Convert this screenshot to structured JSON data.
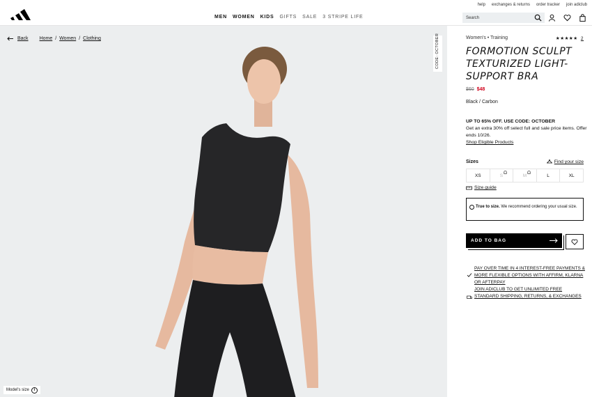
{
  "header": {
    "logo": "adidas-logo",
    "utility_links": [
      "help",
      "exchanges & returns",
      "order tracker",
      "join adiclub"
    ],
    "nav": [
      {
        "label": "MEN",
        "bold": true
      },
      {
        "label": "WOMEN",
        "bold": true
      },
      {
        "label": "KIDS",
        "bold": true
      },
      {
        "label": "GIFTS",
        "bold": false
      },
      {
        "label": "SALE",
        "bold": false
      },
      {
        "label": "3 STRIPE LIFE",
        "bold": false
      }
    ],
    "search_placeholder": "Search"
  },
  "breadcrumb": {
    "back": "Back",
    "items": [
      "Home",
      "Women",
      "Clothing"
    ],
    "separator": "/"
  },
  "image": {
    "code_badge": "CODE: OCTOBER",
    "model_size": "Model's size"
  },
  "product": {
    "category": "Women's • Training",
    "rating_stars": 5,
    "rating_count": "2",
    "title": "FORMOTION SCULPT TEXTURIZED LIGHT-SUPPORT BRA",
    "original_price": "$60",
    "sale_price": "$48",
    "color": "Black / Carbon",
    "promo_headline": "UP TO 65% OFF. USE CODE: OCTOBER",
    "promo_text": "Get an extra 30% off select full and sale price items. Offer ends 10/26.",
    "promo_link": "Shop Eligible Products",
    "sizes_label": "Sizes",
    "find_size": "Find your size",
    "sizes": [
      {
        "label": "XS",
        "available": true
      },
      {
        "label": "S",
        "available": false
      },
      {
        "label": "M",
        "available": false
      },
      {
        "label": "L",
        "available": true
      },
      {
        "label": "XL",
        "available": true
      }
    ],
    "size_guide": "Size guide",
    "true_size_bold": "True to size.",
    "true_size_text": " We recommend ordering your usual size.",
    "add_to_bag": "ADD TO BAG",
    "benefits": [
      "PAY OVER TIME IN 4 INTEREST-FREE PAYMENTS & MORE FLEXIBLE OPTIONS WITH AFFIRM, KLARNA OR AFTERPAY",
      "JOIN ADICLUB TO GET UNLIMITED FREE STANDARD SHIPPING, RETURNS, & EXCHANGES"
    ]
  },
  "colors": {
    "sale": "#d0021b",
    "image_bg": "#eceeef",
    "search_bg": "#eceff1"
  }
}
